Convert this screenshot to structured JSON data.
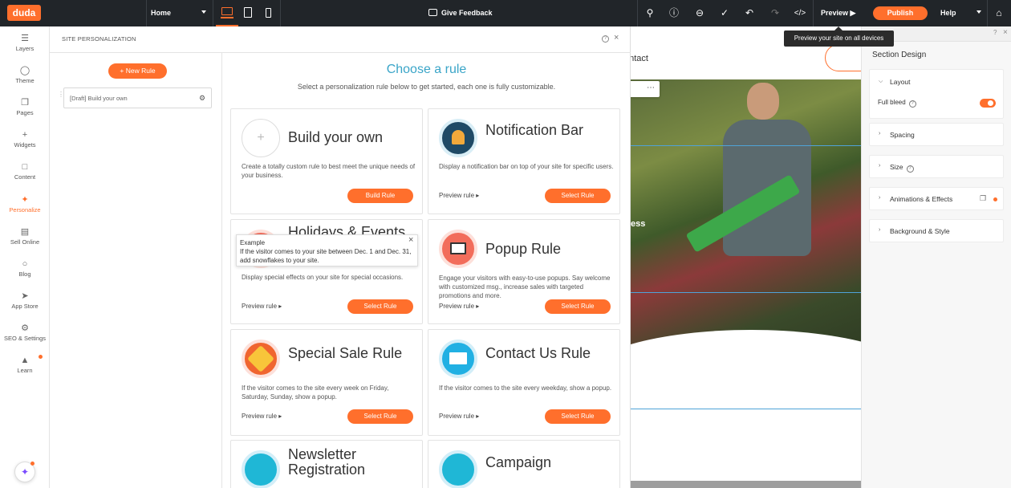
{
  "topbar": {
    "logo": "duda",
    "page_select": "Home",
    "feedback": "Give Feedback",
    "preview": "Preview",
    "publish": "Publish",
    "help": "Help",
    "accent_color": "#ff6f2c"
  },
  "tooltip": "Preview your site on all devices",
  "leftnav": [
    {
      "label": "Layers",
      "icon": "layers-icon"
    },
    {
      "label": "Theme",
      "icon": "palette-icon"
    },
    {
      "label": "Pages",
      "icon": "pages-icon"
    },
    {
      "label": "Widgets",
      "icon": "plus-icon"
    },
    {
      "label": "Content",
      "icon": "folder-icon"
    },
    {
      "label": "Personalize",
      "icon": "personalize-icon"
    },
    {
      "label": "Sell Online",
      "icon": "cart-icon"
    },
    {
      "label": "Blog",
      "icon": "chat-icon"
    },
    {
      "label": "App Store",
      "icon": "rocket-icon"
    },
    {
      "label": "SEO & Settings",
      "icon": "gear-icon"
    },
    {
      "label": "Learn",
      "icon": "graduation-cap-icon"
    }
  ],
  "panel": {
    "title": "SITE PERSONALIZATION",
    "new_rule": "+ New Rule",
    "draft_rule": "[Draft] Build your own",
    "chooser_title": "Choose a rule",
    "chooser_subtitle": "Select a personalization rule below to get started, each one is fully customizable.",
    "preview_link": "Preview rule ▸",
    "cards": [
      {
        "title": "Build your own",
        "desc": "Create a totally custom rule to best meet the unique needs of your business.",
        "button": "Build Rule",
        "has_preview": false
      },
      {
        "title": "Notification Bar",
        "desc": "Display a notification bar on top of your site for specific users.",
        "button": "Select Rule",
        "has_preview": true
      },
      {
        "title": "Holidays & Events",
        "desc": "Display special effects on your site for special occasions.",
        "button": "Select Rule",
        "has_preview": true
      },
      {
        "title": "Popup Rule",
        "desc": "Engage your visitors with easy-to-use popups. Say welcome with customized msg., increase sales with targeted promotions and more.",
        "button": "Select Rule",
        "has_preview": true
      },
      {
        "title": "Special Sale Rule",
        "desc": "If the visitor comes to the site every week on Friday, Saturday, Sunday, show a popup.",
        "button": "Select Rule",
        "has_preview": true
      },
      {
        "title": "Contact Us Rule",
        "desc": "If the visitor comes to the site every weekday, show a popup.",
        "button": "Select Rule",
        "has_preview": true
      },
      {
        "title": "Newsletter Registration",
        "desc": "",
        "button": "",
        "has_preview": false
      },
      {
        "title": "Campaign",
        "desc": "",
        "button": "",
        "has_preview": false
      }
    ],
    "example": {
      "heading": "Example",
      "text": "If the visitor comes to your site between Dec. 1 and Dec. 31, add snowflakes to your site."
    }
  },
  "site": {
    "nav_text": "ontact",
    "hero_fragment": "ess"
  },
  "rightpanel": {
    "title": "Section Design",
    "layout": "Layout",
    "full_bleed": "Full bleed",
    "full_bleed_on": true,
    "sections": [
      "Spacing",
      "Size",
      "Animations & Effects",
      "Background & Style"
    ]
  }
}
